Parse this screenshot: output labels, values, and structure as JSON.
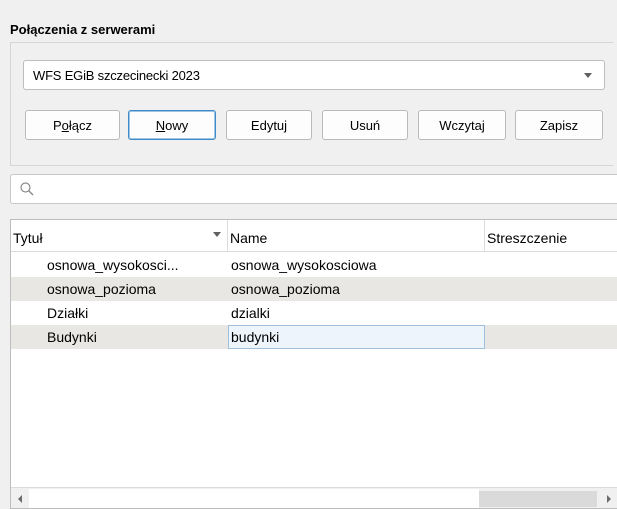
{
  "group": {
    "title": "Połączenia z serwerami"
  },
  "connection": {
    "selected": "WFS EGiB szczecinecki 2023"
  },
  "buttons": {
    "connect": {
      "pre": "P",
      "mn": "o",
      "post": "łącz"
    },
    "new": {
      "pre": "",
      "mn": "N",
      "post": "owy"
    },
    "edit": "Edytuj",
    "delete": "Usuń",
    "load": "Wczytaj",
    "save": "Zapisz"
  },
  "search": {
    "placeholder": "",
    "value": ""
  },
  "table": {
    "columns": [
      {
        "label": "Tytuł",
        "sorted": true
      },
      {
        "label": "Name",
        "sorted": false
      },
      {
        "label": "Streszczenie",
        "sorted": false
      }
    ],
    "rows": [
      {
        "title": "osnowa_wysokosci...",
        "name": "osnowa_wysokosciowa",
        "abstract": ""
      },
      {
        "title": "osnowa_pozioma",
        "name": "osnowa_pozioma",
        "abstract": ""
      },
      {
        "title": "Działki",
        "name": "dzialki",
        "abstract": ""
      },
      {
        "title": "Budynki",
        "name": "budynki",
        "abstract": ""
      }
    ],
    "selected_row": 3
  },
  "icons": {
    "search": "search-icon",
    "combo": "chevron-down-icon",
    "sort": "sort-desc-icon"
  }
}
